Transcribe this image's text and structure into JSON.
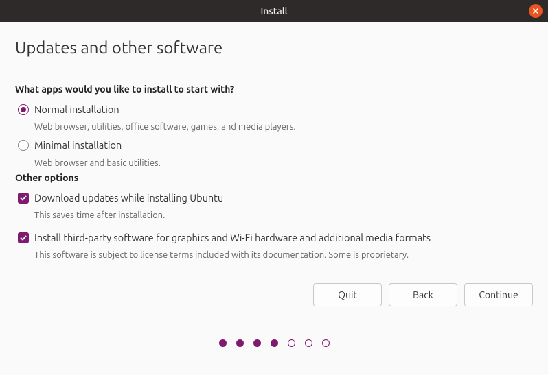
{
  "titlebar": {
    "title": "Install"
  },
  "header": {
    "title": "Updates and other software"
  },
  "section_apps": {
    "label": "What apps would you like to install to start with?",
    "normal": {
      "label": "Normal installation",
      "desc": "Web browser, utilities, office software, games, and media players."
    },
    "minimal": {
      "label": "Minimal installation",
      "desc": "Web browser and basic utilities."
    }
  },
  "section_other": {
    "label": "Other options",
    "download_updates": {
      "label": "Download updates while installing Ubuntu",
      "desc": "This saves time after installation."
    },
    "third_party": {
      "label": "Install third-party software for graphics and Wi-Fi hardware and additional media formats",
      "desc": "This software is subject to license terms included with its documentation. Some is proprietary."
    }
  },
  "buttons": {
    "quit": "Quit",
    "back": "Back",
    "continue": "Continue"
  },
  "progress": {
    "total": 7,
    "completed": 4
  }
}
